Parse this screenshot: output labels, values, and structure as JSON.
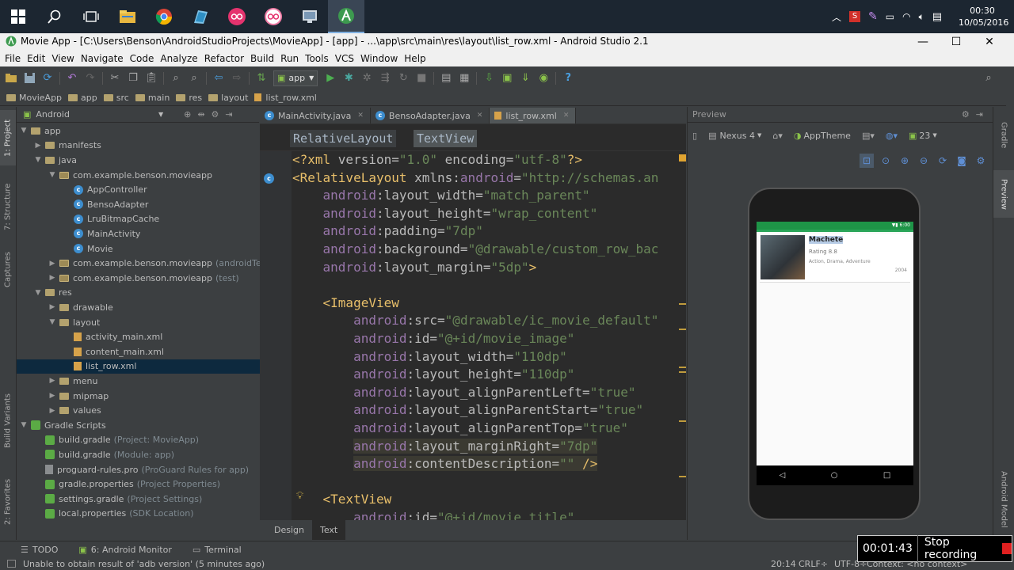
{
  "taskbar": {
    "clock_time": "00:30",
    "clock_date": "10/05/2016"
  },
  "window": {
    "title": "Movie App - [C:\\Users\\Benson\\AndroidStudioProjects\\MovieApp] - [app] - ...\\app\\src\\main\\res\\layout\\list_row.xml - Android Studio 2.1"
  },
  "menu": [
    "File",
    "Edit",
    "View",
    "Navigate",
    "Code",
    "Analyze",
    "Refactor",
    "Build",
    "Run",
    "Tools",
    "VCS",
    "Window",
    "Help"
  ],
  "toolbar": {
    "run_config": "app"
  },
  "breadcrumb": [
    "MovieApp",
    "app",
    "src",
    "main",
    "res",
    "layout",
    "list_row.xml"
  ],
  "left_strip": {
    "project": "1: Project",
    "structure": "7: Structure",
    "captures": "Captures",
    "build_variants": "Build Variants",
    "favorites": "2: Favorites"
  },
  "project_panel": {
    "view_mode": "Android",
    "tree": [
      {
        "label": "app",
        "muted": "",
        "icon": "folder",
        "indent": 0,
        "twisty": "▼"
      },
      {
        "label": "manifests",
        "muted": "",
        "icon": "folder",
        "indent": 1,
        "twisty": "▶"
      },
      {
        "label": "java",
        "muted": "",
        "icon": "folder",
        "indent": 1,
        "twisty": "▼"
      },
      {
        "label": "com.example.benson.movieapp",
        "muted": "",
        "icon": "pkg",
        "indent": 2,
        "twisty": "▼"
      },
      {
        "label": "AppController",
        "muted": "",
        "icon": "class",
        "indent": 3,
        "twisty": ""
      },
      {
        "label": "BensoAdapter",
        "muted": "",
        "icon": "class",
        "indent": 3,
        "twisty": ""
      },
      {
        "label": "LruBitmapCache",
        "muted": "",
        "icon": "class",
        "indent": 3,
        "twisty": ""
      },
      {
        "label": "MainActivity",
        "muted": "",
        "icon": "class",
        "indent": 3,
        "twisty": ""
      },
      {
        "label": "Movie",
        "muted": "",
        "icon": "class",
        "indent": 3,
        "twisty": ""
      },
      {
        "label": "com.example.benson.movieapp",
        "muted": "(androidTest)",
        "icon": "pkg",
        "indent": 2,
        "twisty": "▶"
      },
      {
        "label": "com.example.benson.movieapp",
        "muted": "(test)",
        "icon": "pkg",
        "indent": 2,
        "twisty": "▶"
      },
      {
        "label": "res",
        "muted": "",
        "icon": "folder",
        "indent": 1,
        "twisty": "▼"
      },
      {
        "label": "drawable",
        "muted": "",
        "icon": "folder",
        "indent": 2,
        "twisty": "▶"
      },
      {
        "label": "layout",
        "muted": "",
        "icon": "folder",
        "indent": 2,
        "twisty": "▼"
      },
      {
        "label": "activity_main.xml",
        "muted": "",
        "icon": "xml",
        "indent": 3,
        "twisty": ""
      },
      {
        "label": "content_main.xml",
        "muted": "",
        "icon": "xml",
        "indent": 3,
        "twisty": ""
      },
      {
        "label": "list_row.xml",
        "muted": "",
        "icon": "xml",
        "indent": 3,
        "twisty": "",
        "selected": true
      },
      {
        "label": "menu",
        "muted": "",
        "icon": "folder",
        "indent": 2,
        "twisty": "▶"
      },
      {
        "label": "mipmap",
        "muted": "",
        "icon": "folder",
        "indent": 2,
        "twisty": "▶"
      },
      {
        "label": "values",
        "muted": "",
        "icon": "folder",
        "indent": 2,
        "twisty": "▶"
      },
      {
        "label": "Gradle Scripts",
        "muted": "",
        "icon": "gradle",
        "indent": 0,
        "twisty": "▼"
      },
      {
        "label": "build.gradle",
        "muted": "(Project: MovieApp)",
        "icon": "gradle",
        "indent": 1,
        "twisty": ""
      },
      {
        "label": "build.gradle",
        "muted": "(Module: app)",
        "icon": "gradle",
        "indent": 1,
        "twisty": ""
      },
      {
        "label": "proguard-rules.pro",
        "muted": "(ProGuard Rules for app)",
        "icon": "file",
        "indent": 1,
        "twisty": ""
      },
      {
        "label": "gradle.properties",
        "muted": "(Project Properties)",
        "icon": "gradle",
        "indent": 1,
        "twisty": ""
      },
      {
        "label": "settings.gradle",
        "muted": "(Project Settings)",
        "icon": "gradle",
        "indent": 1,
        "twisty": ""
      },
      {
        "label": "local.properties",
        "muted": "(SDK Location)",
        "icon": "gradle",
        "indent": 1,
        "twisty": ""
      }
    ]
  },
  "editor": {
    "tabs": [
      {
        "label": "MainActivity.java",
        "icon": "class"
      },
      {
        "label": "BensoAdapter.java",
        "icon": "class"
      },
      {
        "label": "list_row.xml",
        "icon": "xml",
        "active": true
      }
    ],
    "crumbs": [
      "RelativeLayout",
      "TextView"
    ],
    "code": [
      [
        [
          "tag",
          "<?xml "
        ],
        [
          "attr",
          "version="
        ],
        [
          "str",
          "\"1.0\""
        ],
        [
          "attr",
          " encoding="
        ],
        [
          "str",
          "\"utf-8\""
        ],
        [
          "tag",
          "?>"
        ]
      ],
      [
        [
          "tag",
          "<RelativeLayout "
        ],
        [
          "attr",
          "xmlns:"
        ],
        [
          "ns",
          "android"
        ],
        [
          "attr",
          "="
        ],
        [
          "str",
          "\"http://schemas.an"
        ]
      ],
      [
        [
          "attr",
          "    "
        ],
        [
          "ns",
          "android"
        ],
        [
          "attr",
          ":layout_width="
        ],
        [
          "str",
          "\"match_parent\""
        ]
      ],
      [
        [
          "attr",
          "    "
        ],
        [
          "ns",
          "android"
        ],
        [
          "attr",
          ":layout_height="
        ],
        [
          "str",
          "\"wrap_content\""
        ]
      ],
      [
        [
          "attr",
          "    "
        ],
        [
          "ns",
          "android"
        ],
        [
          "attr",
          ":padding="
        ],
        [
          "str",
          "\"7dp\""
        ]
      ],
      [
        [
          "attr",
          "    "
        ],
        [
          "ns",
          "android"
        ],
        [
          "attr",
          ":background="
        ],
        [
          "str",
          "\"@drawable/custom_row_bac"
        ]
      ],
      [
        [
          "attr",
          "    "
        ],
        [
          "ns",
          "android"
        ],
        [
          "attr",
          ":layout_margin="
        ],
        [
          "str",
          "\"5dp\""
        ],
        [
          "tag",
          ">"
        ]
      ],
      [
        [
          "attr",
          ""
        ]
      ],
      [
        [
          "attr",
          "    "
        ],
        [
          "tag",
          "<ImageView"
        ]
      ],
      [
        [
          "attr",
          "        "
        ],
        [
          "ns",
          "android"
        ],
        [
          "attr",
          ":src="
        ],
        [
          "str",
          "\"@drawable/ic_movie_default\""
        ]
      ],
      [
        [
          "attr",
          "        "
        ],
        [
          "ns",
          "android"
        ],
        [
          "attr",
          ":id="
        ],
        [
          "str",
          "\"@+id/movie_image\""
        ]
      ],
      [
        [
          "attr",
          "        "
        ],
        [
          "ns",
          "android"
        ],
        [
          "attr",
          ":layout_width="
        ],
        [
          "str",
          "\"110dp\""
        ]
      ],
      [
        [
          "attr",
          "        "
        ],
        [
          "ns",
          "android"
        ],
        [
          "attr",
          ":layout_height="
        ],
        [
          "str",
          "\"110dp\""
        ]
      ],
      [
        [
          "attr",
          "        "
        ],
        [
          "ns",
          "android"
        ],
        [
          "attr",
          ":layout_alignParentLeft="
        ],
        [
          "str",
          "\"true\""
        ]
      ],
      [
        [
          "attr",
          "        "
        ],
        [
          "ns",
          "android"
        ],
        [
          "attr",
          ":layout_alignParentStart="
        ],
        [
          "str",
          "\"true\""
        ]
      ],
      [
        [
          "attr",
          "        "
        ],
        [
          "ns",
          "android"
        ],
        [
          "attr",
          ":layout_alignParentTop="
        ],
        [
          "str",
          "\"true\""
        ]
      ],
      [
        [
          "attr",
          "        "
        ],
        [
          "ns",
          "android"
        ],
        [
          "attr",
          ":layout_marginRight="
        ],
        [
          "str",
          "\"7dp\""
        ]
      ],
      [
        [
          "attr",
          "        "
        ],
        [
          "ns",
          "android"
        ],
        [
          "attr",
          ":contentDescription="
        ],
        [
          "str",
          "\"\""
        ],
        [
          "tag",
          " />"
        ]
      ],
      [
        [
          "attr",
          ""
        ]
      ],
      [
        [
          "attr",
          "    "
        ],
        [
          "tag",
          "<TextView"
        ]
      ],
      [
        [
          "attr",
          "        "
        ],
        [
          "ns",
          "android"
        ],
        [
          "attr",
          ":id="
        ],
        [
          "str",
          "\"@+id/movie_title\""
        ]
      ]
    ],
    "design_tabs": [
      "Design",
      "Text"
    ]
  },
  "preview": {
    "title": "Preview",
    "device": "Nexus 4",
    "theme": "AppTheme",
    "api": "23",
    "status_time": "6:00",
    "movie_title": "Machete",
    "movie_rating": "Rating 8.8",
    "movie_genre": "Action, Drama, Adventure",
    "movie_year": "2004"
  },
  "right_strip": {
    "gradle": "Gradle",
    "preview": "Preview",
    "android_model": "Android Model"
  },
  "bottom_tools": [
    "TODO",
    "6: Android Monitor",
    "Terminal"
  ],
  "status": {
    "message": "Unable to obtain result of 'adb version' (5 minutes ago)",
    "position": "20:14",
    "line_sep": "CRLF÷",
    "encoding": "UTF-8÷",
    "context": "Context: <no context>"
  },
  "recorder": {
    "elapsed": "00:01:43",
    "stop_label": "Stop recording"
  },
  "colors": {
    "accent_green": "#1e9447",
    "selection": "#0d293e",
    "record_red": "#e02020"
  }
}
